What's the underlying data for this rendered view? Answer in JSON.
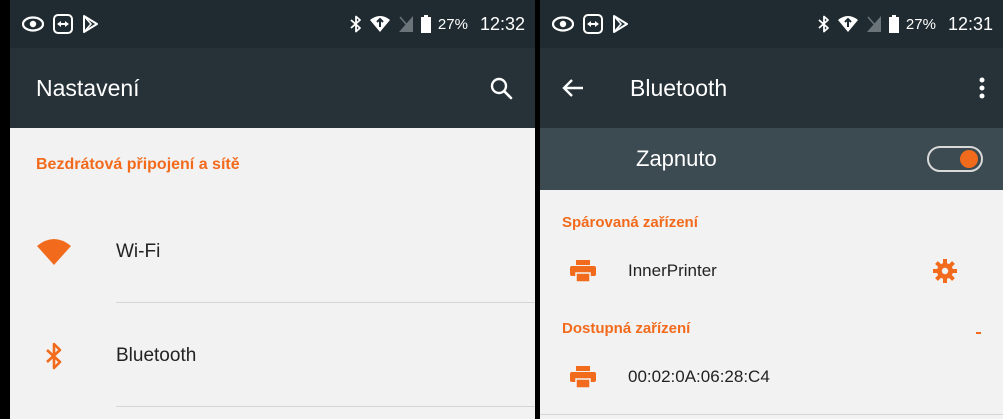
{
  "colors": {
    "accent": "#F26B1D",
    "statusbar": "#1F2B30",
    "toolbar": "#263238",
    "switch_bar": "#3C4A51",
    "background": "#F2F2F2",
    "text": "#222222"
  },
  "left_screen": {
    "status_bar": {
      "left_icons": [
        "eye-icon",
        "teamviewer-icon",
        "play-store-icon"
      ],
      "right_icons": [
        "bluetooth-icon",
        "wifi-icon",
        "no-sim-icon",
        "battery-icon"
      ],
      "battery": "27%",
      "time": "12:32"
    },
    "toolbar": {
      "title": "Nastavení",
      "search_icon": "search-icon"
    },
    "section_header": "Bezdrátová připojení a sítě",
    "items": [
      {
        "label": "Wi-Fi",
        "icon": "wifi-icon"
      },
      {
        "label": "Bluetooth",
        "icon": "bluetooth-icon"
      }
    ]
  },
  "right_screen": {
    "status_bar": {
      "left_icons": [
        "eye-icon",
        "teamviewer-icon",
        "play-store-icon"
      ],
      "right_icons": [
        "bluetooth-icon",
        "wifi-icon",
        "no-sim-icon",
        "battery-icon"
      ],
      "battery": "27%",
      "time": "12:31"
    },
    "toolbar": {
      "title": "Bluetooth",
      "back_icon": "back-arrow-icon",
      "menu_icon": "more-vert-icon"
    },
    "master_switch": {
      "label": "Zapnuto",
      "on": true
    },
    "paired_header": "Spárovaná zařízení",
    "paired_devices": [
      {
        "name": "InnerPrinter",
        "icon": "printer-icon",
        "settings_icon": "gear-icon"
      }
    ],
    "available_header": "Dostupná zařízení",
    "available_devices": [
      {
        "name": "00:02:0A:06:28:C4",
        "icon": "printer-icon"
      }
    ]
  }
}
